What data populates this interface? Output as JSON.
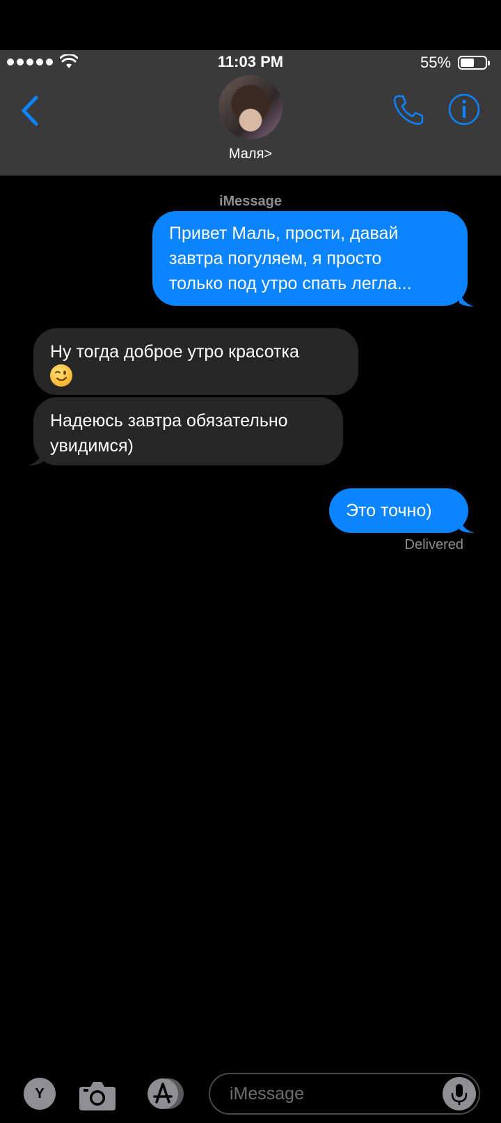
{
  "status_bar": {
    "time": "11:03 PM",
    "battery_percent": "55%",
    "battery_level": 0.55,
    "signal_bars": 5
  },
  "header": {
    "contact_name": "Маля>",
    "icons": [
      "chevron-left-icon",
      "phone-icon",
      "info-icon"
    ],
    "accent_color": "#0a84ff"
  },
  "conversation": {
    "service_label": "iMessage",
    "messages": [
      {
        "direction": "outgoing",
        "lines": [
          "Привет Маль, прости, давай",
          "завтра погуляем, я просто",
          "только под утро спать легла..."
        ]
      },
      {
        "direction": "incoming",
        "lines": [
          "Ну тогда доброе утро красотка"
        ],
        "emoji": "winking-face"
      },
      {
        "direction": "incoming",
        "lines": [
          "Надеюсь завтра обязательно",
          "увидимся)"
        ]
      },
      {
        "direction": "outgoing",
        "lines": [
          "Это точно)"
        ]
      }
    ],
    "delivery_status": "Delivered"
  },
  "input_bar": {
    "app_button_label": "Y",
    "placeholder": "iMessage",
    "icons": [
      "camera-icon",
      "app-store-icon",
      "microphone-icon"
    ]
  }
}
